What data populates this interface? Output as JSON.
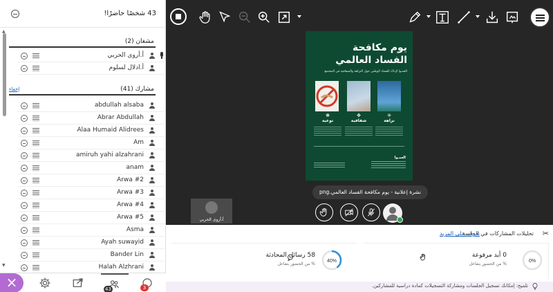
{
  "attendees": {
    "header_title": "43 شخصًا حاضرًا!",
    "presenters_title": "مشغان (2)",
    "presenters": [
      {
        "name": "أ.أروى الحربي"
      },
      {
        "name": "أ.ادلال لسلوم"
      }
    ],
    "participants_title": "مشارك (41)",
    "participants_link": "إخفاء",
    "participants": [
      {
        "name": "abdullah alsaba"
      },
      {
        "name": "Abrar Abdullah"
      },
      {
        "name": "Alaa Humaid Alidrees"
      },
      {
        "name": "Am"
      },
      {
        "name": "amiruh yahi alzahrani"
      },
      {
        "name": "anam"
      },
      {
        "name": "Arwa #2"
      },
      {
        "name": "Arwa #3"
      },
      {
        "name": "Arwa #4"
      },
      {
        "name": "Arwa #5"
      },
      {
        "name": "Asma"
      },
      {
        "name": "Ayah suwayid"
      },
      {
        "name": "Bander Lin"
      },
      {
        "name": "Halah Alzhrani"
      }
    ]
  },
  "bottom_bar": {
    "attendees_badge": "43",
    "chat_badge": "3"
  },
  "stage": {
    "file_caption": "نشرة إعلانية - يوم مكافحة الفساد العالمي.png",
    "video_name": "أ.أروى الحربي",
    "poster": {
      "title_line1": "يوم مكافحة",
      "title_line2": "الفساد العالمي",
      "subtitle": "العمـوا لإيـاك الفساد الوطني حول النزاهة والشفافية في المجتمع",
      "items": [
        {
          "label": "نزاهة",
          "symbol": "⁜"
        },
        {
          "label": "شفافية",
          "symbol": "✥"
        },
        {
          "label": "توعية",
          "symbol": "❋"
        }
      ],
      "footer": "العمـوا"
    }
  },
  "engagement": {
    "title": "تحليلات المشاركات في الجلسة",
    "link": "تعرف على المزيد",
    "hands_value": "0 أيد مرفوعة",
    "hands_sub": "% من الحضور بتفاعل",
    "hands_percent": "0%",
    "chat_value": "58 رسائل المحادثة",
    "chat_sub": "% من الحضور بتفاعل",
    "chat_percent": "40%",
    "chat_fraction": 0.4,
    "tip": "تلميح: إمكانك تسجيل الجلسات ومشاركة التسجيلات كمادة دراسية للمشاركين."
  },
  "colors": {
    "accent": "#b36bd3",
    "ring_blue": "#2f8fd8",
    "stage_bg": "#262626",
    "poster_bg": "#0e4a32"
  }
}
